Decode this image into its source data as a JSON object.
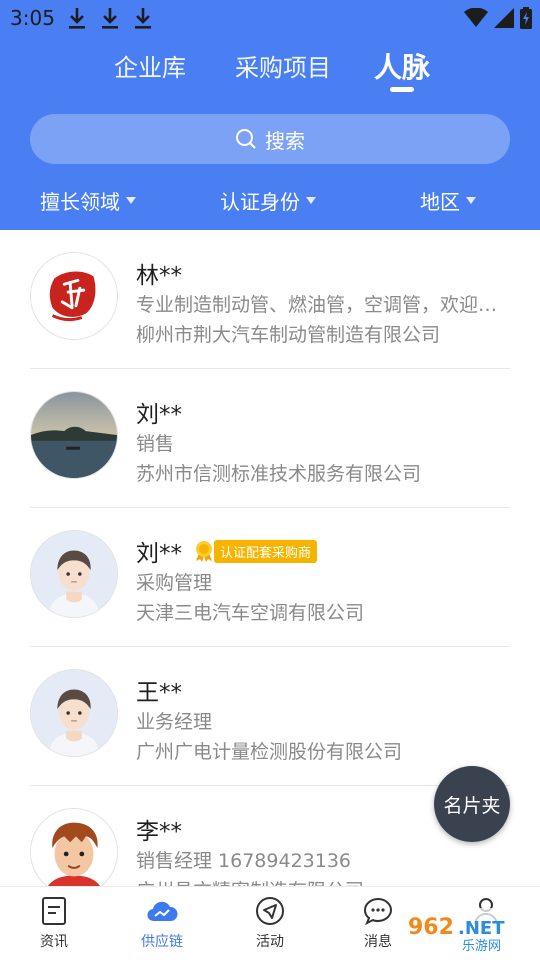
{
  "status_bar": {
    "time": "3:05"
  },
  "tabs": [
    {
      "label": "企业库"
    },
    {
      "label": "采购项目"
    },
    {
      "label": "人脉"
    }
  ],
  "search": {
    "label": "搜索"
  },
  "filters": [
    {
      "label": "擅长领域"
    },
    {
      "label": "认证身份"
    },
    {
      "label": "地区"
    }
  ],
  "contacts": [
    {
      "name": "林**",
      "line2": "专业制造制动管、燃油管，空调管，欢迎咨询",
      "line3": "柳州市荆大汽车制动管制造有限公司",
      "badge": ""
    },
    {
      "name": "刘**",
      "line2": "销售",
      "line3": "苏州市信测标准技术服务有限公司",
      "badge": ""
    },
    {
      "name": "刘**",
      "line2": "采购管理",
      "line3": "天津三电汽车空调有限公司",
      "badge": "认证配套采购商"
    },
    {
      "name": "王**",
      "line2": "业务经理",
      "line3": "广州广电计量检测股份有限公司",
      "badge": ""
    },
    {
      "name": "李**",
      "line2": "销售经理 16789423136",
      "line3": "广州昌方精密制造有限公司",
      "badge": ""
    }
  ],
  "fab": {
    "label": "名片夹"
  },
  "bottom_nav": [
    {
      "label": "资讯",
      "icon": "news-icon"
    },
    {
      "label": "供应链",
      "icon": "cloud-icon"
    },
    {
      "label": "活动",
      "icon": "navigation-arrow-icon"
    },
    {
      "label": "消息",
      "icon": "chat-bubble-icon"
    },
    {
      "label": "",
      "icon": "profile-icon"
    }
  ],
  "colors": {
    "primary": "#4a7ff3",
    "nav_active": "#3d7af0",
    "badge": "#f6b400",
    "fab": "#3a4250"
  },
  "watermark": {
    "text": "962.NET",
    "sub": "乐游网"
  }
}
